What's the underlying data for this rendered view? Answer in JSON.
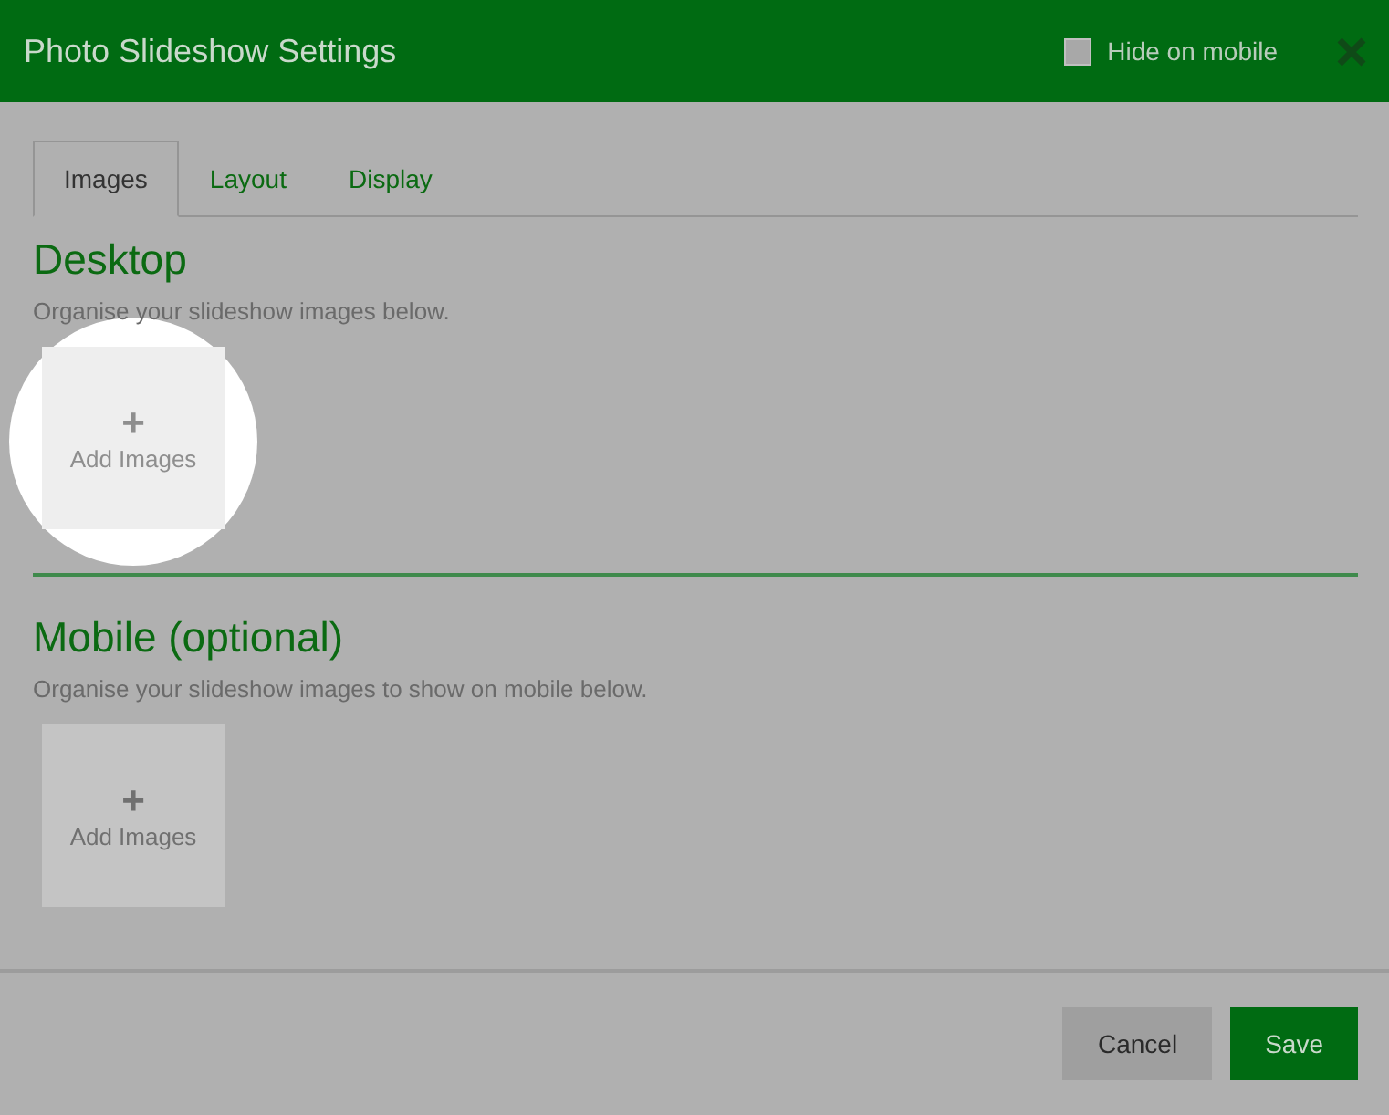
{
  "window": {
    "title": "Photo Slideshow Settings"
  },
  "hide_on_mobile": {
    "label": "Hide on mobile",
    "checked": false
  },
  "tabs": [
    {
      "label": "Images",
      "selected": true
    },
    {
      "label": "Layout",
      "selected": false
    },
    {
      "label": "Display",
      "selected": false
    }
  ],
  "sections": [
    {
      "title": "Desktop",
      "description": "Organise your slideshow images below.",
      "tile": {
        "icon": "+",
        "label": "Add Images"
      },
      "highlighted": true
    },
    {
      "title": "Mobile (optional)",
      "description": "Organise your slideshow images to show on mobile below.",
      "tile": {
        "icon": "+",
        "label": "Add Images"
      },
      "highlighted": false
    }
  ],
  "buttons": [
    {
      "label": "Cancel",
      "kind": "secondary"
    },
    {
      "label": "Save",
      "kind": "primary"
    }
  ]
}
